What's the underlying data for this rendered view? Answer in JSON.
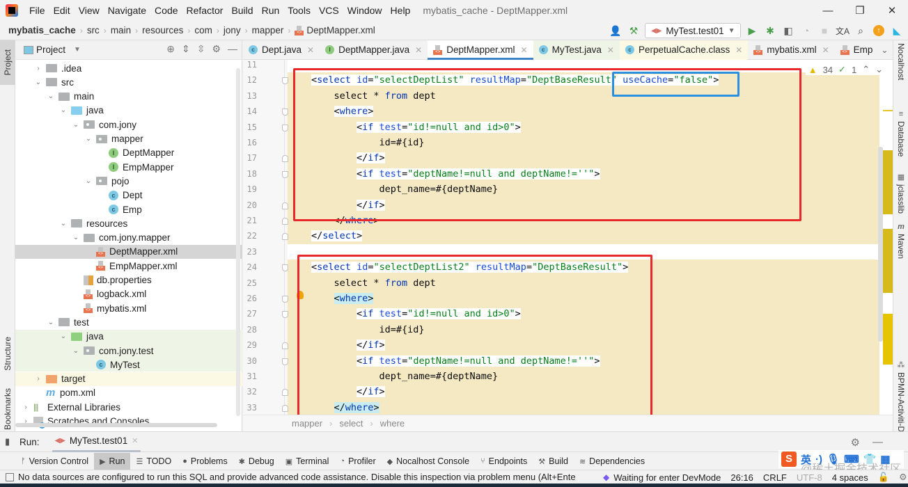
{
  "titlebar": {
    "menu": [
      "File",
      "Edit",
      "View",
      "Navigate",
      "Code",
      "Refactor",
      "Build",
      "Run",
      "Tools",
      "VCS",
      "Window",
      "Help"
    ],
    "window_title": "mybatis_cache - DeptMapper.xml",
    "controls": {
      "minimize": "—",
      "restore": "❐",
      "close": "✕"
    }
  },
  "navbar": {
    "breadcrumb": [
      "mybatis_cache",
      "src",
      "main",
      "resources",
      "com",
      "jony",
      "mapper",
      "DeptMapper.xml"
    ],
    "run_config": "MyTest.test01",
    "icons": [
      "user-icon",
      "hammer-icon",
      "run-icon",
      "debug-icon",
      "coverage-icon",
      "profiler-icon",
      "stop-icon",
      "translate-icon",
      "search-icon",
      "update-icon",
      "plugin-icon"
    ]
  },
  "left_strip": {
    "tabs": [
      "Project",
      "Structure",
      "Bookmarks"
    ]
  },
  "project": {
    "title": "Project",
    "tree": [
      {
        "label": ".idea",
        "level": 1,
        "arrow": "›",
        "icon": "folder"
      },
      {
        "label": "src",
        "level": 1,
        "arrow": "⌄",
        "icon": "folder"
      },
      {
        "label": "main",
        "level": 2,
        "arrow": "⌄",
        "icon": "folder"
      },
      {
        "label": "java",
        "level": 3,
        "arrow": "⌄",
        "icon": "folder-blue"
      },
      {
        "label": "com.jony",
        "level": 4,
        "arrow": "⌄",
        "icon": "package"
      },
      {
        "label": "mapper",
        "level": 5,
        "arrow": "⌄",
        "icon": "package"
      },
      {
        "label": "DeptMapper",
        "level": 6,
        "arrow": "",
        "icon": "interface"
      },
      {
        "label": "EmpMapper",
        "level": 6,
        "arrow": "",
        "icon": "interface"
      },
      {
        "label": "pojo",
        "level": 5,
        "arrow": "⌄",
        "icon": "package"
      },
      {
        "label": "Dept",
        "level": 6,
        "arrow": "",
        "icon": "class"
      },
      {
        "label": "Emp",
        "level": 6,
        "arrow": "",
        "icon": "class"
      },
      {
        "label": "resources",
        "level": 3,
        "arrow": "⌄",
        "icon": "folder"
      },
      {
        "label": "com.jony.mapper",
        "level": 4,
        "arrow": "⌄",
        "icon": "folder"
      },
      {
        "label": "DeptMapper.xml",
        "level": 5,
        "arrow": "",
        "icon": "xml",
        "selected": true
      },
      {
        "label": "EmpMapper.xml",
        "level": 5,
        "arrow": "",
        "icon": "xml"
      },
      {
        "label": "db.properties",
        "level": 4,
        "arrow": "",
        "icon": "properties"
      },
      {
        "label": "logback.xml",
        "level": 4,
        "arrow": "",
        "icon": "xml"
      },
      {
        "label": "mybatis.xml",
        "level": 4,
        "arrow": "",
        "icon": "xml"
      },
      {
        "label": "test",
        "level": 2,
        "arrow": "⌄",
        "icon": "folder"
      },
      {
        "label": "java",
        "level": 3,
        "arrow": "⌄",
        "icon": "folder-green",
        "tint": "green"
      },
      {
        "label": "com.jony.test",
        "level": 4,
        "arrow": "⌄",
        "icon": "package",
        "tint": "green"
      },
      {
        "label": "MyTest",
        "level": 5,
        "arrow": "",
        "icon": "class",
        "tint": "green"
      },
      {
        "label": "target",
        "level": 1,
        "arrow": "›",
        "icon": "folder-orange",
        "tint": "yellow"
      },
      {
        "label": "pom.xml",
        "level": 1,
        "arrow": "",
        "icon": "maven"
      },
      {
        "label": "External Libraries",
        "level": 0,
        "arrow": "›",
        "icon": "library"
      },
      {
        "label": "Scratches and Consoles",
        "level": 0,
        "arrow": "›",
        "icon": "scratch"
      }
    ]
  },
  "tabs": [
    {
      "label": "Dept.java",
      "icon": "class"
    },
    {
      "label": "DeptMapper.java",
      "icon": "interface"
    },
    {
      "label": "DeptMapper.xml",
      "icon": "xml",
      "active": true
    },
    {
      "label": "MyTest.java",
      "icon": "class",
      "tint": "green"
    },
    {
      "label": "PerpetualCache.class",
      "icon": "class",
      "tint": "yellow"
    },
    {
      "label": "mybatis.xml",
      "icon": "xml"
    },
    {
      "label": "Emp",
      "icon": "xml"
    }
  ],
  "editor": {
    "inspections": {
      "warnings": "34",
      "ok": "1"
    },
    "lines": [
      {
        "n": "11",
        "indent": 0,
        "tokens": []
      },
      {
        "n": "12",
        "indent": 1,
        "tokens": [
          [
            "p",
            "<"
          ],
          [
            "tg",
            "select"
          ],
          [
            "p",
            " "
          ],
          [
            "at",
            "id"
          ],
          [
            "p",
            "="
          ],
          [
            "av",
            "\"selectDeptList\""
          ],
          [
            "p",
            " "
          ],
          [
            "at",
            "resultMap"
          ],
          [
            "p",
            "="
          ],
          [
            "av",
            "\"DeptBaseResult\""
          ],
          [
            "p",
            " "
          ],
          [
            "at",
            "useCache"
          ],
          [
            "p",
            "="
          ],
          [
            "av",
            "\"false\""
          ],
          [
            "p",
            ">"
          ]
        ]
      },
      {
        "n": "13",
        "indent": 2,
        "tokens": [
          [
            "p",
            "select * "
          ],
          [
            "kw",
            "from"
          ],
          [
            "p",
            " dept"
          ]
        ]
      },
      {
        "n": "14",
        "indent": 2,
        "tokens": [
          [
            "p",
            "<"
          ],
          [
            "tg",
            "where"
          ],
          [
            "p",
            ">"
          ]
        ]
      },
      {
        "n": "15",
        "indent": 3,
        "tokens": [
          [
            "p",
            "<"
          ],
          [
            "tg",
            "if"
          ],
          [
            "p",
            " "
          ],
          [
            "at",
            "test"
          ],
          [
            "p",
            "="
          ],
          [
            "av",
            "\"id!=null and id>0\""
          ],
          [
            "p",
            ">"
          ]
        ]
      },
      {
        "n": "16",
        "indent": 4,
        "tokens": [
          [
            "p",
            "id=#{id}"
          ]
        ]
      },
      {
        "n": "17",
        "indent": 3,
        "tokens": [
          [
            "p",
            "</"
          ],
          [
            "tg",
            "if"
          ],
          [
            "p",
            ">"
          ]
        ]
      },
      {
        "n": "18",
        "indent": 3,
        "tokens": [
          [
            "p",
            "<"
          ],
          [
            "tg",
            "if"
          ],
          [
            "p",
            " "
          ],
          [
            "at",
            "test"
          ],
          [
            "p",
            "="
          ],
          [
            "av",
            "\"deptName!=null and deptName!=''\""
          ],
          [
            "p",
            ">"
          ]
        ]
      },
      {
        "n": "19",
        "indent": 4,
        "tokens": [
          [
            "p",
            "dept_name=#{deptName}"
          ]
        ]
      },
      {
        "n": "20",
        "indent": 3,
        "tokens": [
          [
            "p",
            "</"
          ],
          [
            "tg",
            "if"
          ],
          [
            "p",
            ">"
          ]
        ]
      },
      {
        "n": "21",
        "indent": 2,
        "tokens": [
          [
            "p",
            "</"
          ],
          [
            "tg",
            "where"
          ],
          [
            "p",
            ">"
          ]
        ]
      },
      {
        "n": "22",
        "indent": 1,
        "tokens": [
          [
            "p",
            "</"
          ],
          [
            "tg",
            "select"
          ],
          [
            "p",
            ">"
          ]
        ]
      },
      {
        "n": "23",
        "indent": 0,
        "tokens": []
      },
      {
        "n": "24",
        "indent": 1,
        "tokens": [
          [
            "p",
            "<"
          ],
          [
            "tg",
            "select"
          ],
          [
            "p",
            " "
          ],
          [
            "at",
            "id"
          ],
          [
            "p",
            "="
          ],
          [
            "av",
            "\"selectDeptList2\""
          ],
          [
            "p",
            " "
          ],
          [
            "at",
            "resultMap"
          ],
          [
            "p",
            "="
          ],
          [
            "av",
            "\"DeptBaseResult\""
          ],
          [
            "p",
            ">"
          ]
        ]
      },
      {
        "n": "25",
        "indent": 2,
        "tokens": [
          [
            "p",
            "select * "
          ],
          [
            "kw",
            "from"
          ],
          [
            "p",
            " dept"
          ]
        ]
      },
      {
        "n": "26",
        "indent": 2,
        "tokens": [
          [
            "p",
            "<"
          ],
          [
            "tg",
            "where"
          ],
          [
            "p",
            ">"
          ]
        ],
        "cyan": true
      },
      {
        "n": "27",
        "indent": 3,
        "tokens": [
          [
            "p",
            "<"
          ],
          [
            "tg",
            "if"
          ],
          [
            "p",
            " "
          ],
          [
            "at",
            "test"
          ],
          [
            "p",
            "="
          ],
          [
            "av",
            "\"id!=null and id>0\""
          ],
          [
            "p",
            ">"
          ]
        ]
      },
      {
        "n": "28",
        "indent": 4,
        "tokens": [
          [
            "p",
            "id=#{id}"
          ]
        ]
      },
      {
        "n": "29",
        "indent": 3,
        "tokens": [
          [
            "p",
            "</"
          ],
          [
            "tg",
            "if"
          ],
          [
            "p",
            ">"
          ]
        ]
      },
      {
        "n": "30",
        "indent": 3,
        "tokens": [
          [
            "p",
            "<"
          ],
          [
            "tg",
            "if"
          ],
          [
            "p",
            " "
          ],
          [
            "at",
            "test"
          ],
          [
            "p",
            "="
          ],
          [
            "av",
            "\"deptName!=null and deptName!=''\""
          ],
          [
            "p",
            ">"
          ]
        ]
      },
      {
        "n": "31",
        "indent": 4,
        "tokens": [
          [
            "p",
            "dept_name=#{deptName}"
          ]
        ]
      },
      {
        "n": "32",
        "indent": 3,
        "tokens": [
          [
            "p",
            "</"
          ],
          [
            "tg",
            "if"
          ],
          [
            "p",
            ">"
          ]
        ]
      },
      {
        "n": "33",
        "indent": 2,
        "tokens": [
          [
            "p",
            "</"
          ],
          [
            "tg",
            "where"
          ],
          [
            "p",
            ">"
          ]
        ],
        "cyan": true
      }
    ],
    "breadcrumb": [
      "mapper",
      "select",
      "where"
    ]
  },
  "right_strip": {
    "tabs": [
      "Nocalhost",
      "Database",
      "jclasslib",
      "Maven",
      "BPMN-Activiti-Diagram"
    ]
  },
  "run_panel": {
    "label": "Run:",
    "tab": "MyTest.test01"
  },
  "tool_windows": [
    {
      "label": "Version Control",
      "icon": "vcs-icon",
      "glyph": "ᚠ"
    },
    {
      "label": "Run",
      "icon": "run-icon",
      "glyph": "▶",
      "active": true
    },
    {
      "label": "TODO",
      "icon": "todo-icon",
      "glyph": "☰"
    },
    {
      "label": "Problems",
      "icon": "problems-icon",
      "glyph": "●"
    },
    {
      "label": "Debug",
      "icon": "debug-icon",
      "glyph": "✱"
    },
    {
      "label": "Terminal",
      "icon": "terminal-icon",
      "glyph": "▣"
    },
    {
      "label": "Profiler",
      "icon": "profiler-icon",
      "glyph": "◔"
    },
    {
      "label": "Nocalhost Console",
      "icon": "nocalhost-icon",
      "glyph": "◆"
    },
    {
      "label": "Endpoints",
      "icon": "endpoints-icon",
      "glyph": "⑂"
    },
    {
      "label": "Build",
      "icon": "build-icon",
      "glyph": "⚒"
    },
    {
      "label": "Dependencies",
      "icon": "dependencies-icon",
      "glyph": "≋"
    }
  ],
  "statusbar": {
    "message": "No data sources are configured to run this SQL and provide advanced code assistance. Disable this inspection via problem menu (Alt+Ente",
    "devmode": "Waiting for enter DevMode",
    "position": "26:16",
    "line_sep": "CRLF",
    "encoding": "UTF-8",
    "indent": "4 spaces"
  },
  "overlay": {
    "ime_label": "英",
    "watermark": "@稀土掘金技术社区"
  },
  "colors": {
    "accent": "#4083c9",
    "red_box": "#e8282b",
    "blue_box": "#2b8fe0",
    "highlight": "#f5e9c4"
  }
}
